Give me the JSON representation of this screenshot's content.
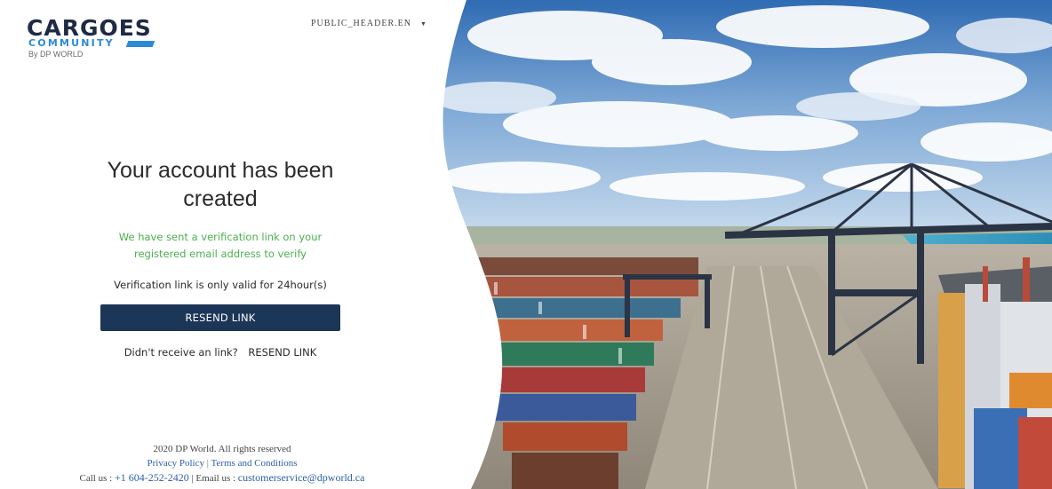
{
  "logo": {
    "word": "CARGOES",
    "community": "COMMUNITY",
    "by": "By DP WORLD"
  },
  "language": {
    "selected": "PUBLIC_HEADER.EN",
    "caret": "▼"
  },
  "main": {
    "title": "Your account has been created",
    "sent_message": "We have sent a verification link on your registered email address to verify",
    "valid_message": "Verification link is only valid for 24hour(s)",
    "resend_button": "RESEND LINK",
    "didnt_receive": "Didn't receive an link?",
    "resend_link": "RESEND LINK"
  },
  "footer": {
    "copyright": "2020 DP World. All rights reserved",
    "privacy": "Privacy Policy",
    "separator": "|",
    "terms": "Terms and Conditions",
    "call_label": "Call us :",
    "phone": "+1 604-252-2420",
    "email_label": "| Email us :",
    "email": "customerservice@dpworld.ca"
  },
  "colors": {
    "brand_navy": "#1c3657",
    "logo_blue": "#2b8ad6",
    "success_green": "#4bb04e",
    "link_blue": "#2b5fa8"
  }
}
